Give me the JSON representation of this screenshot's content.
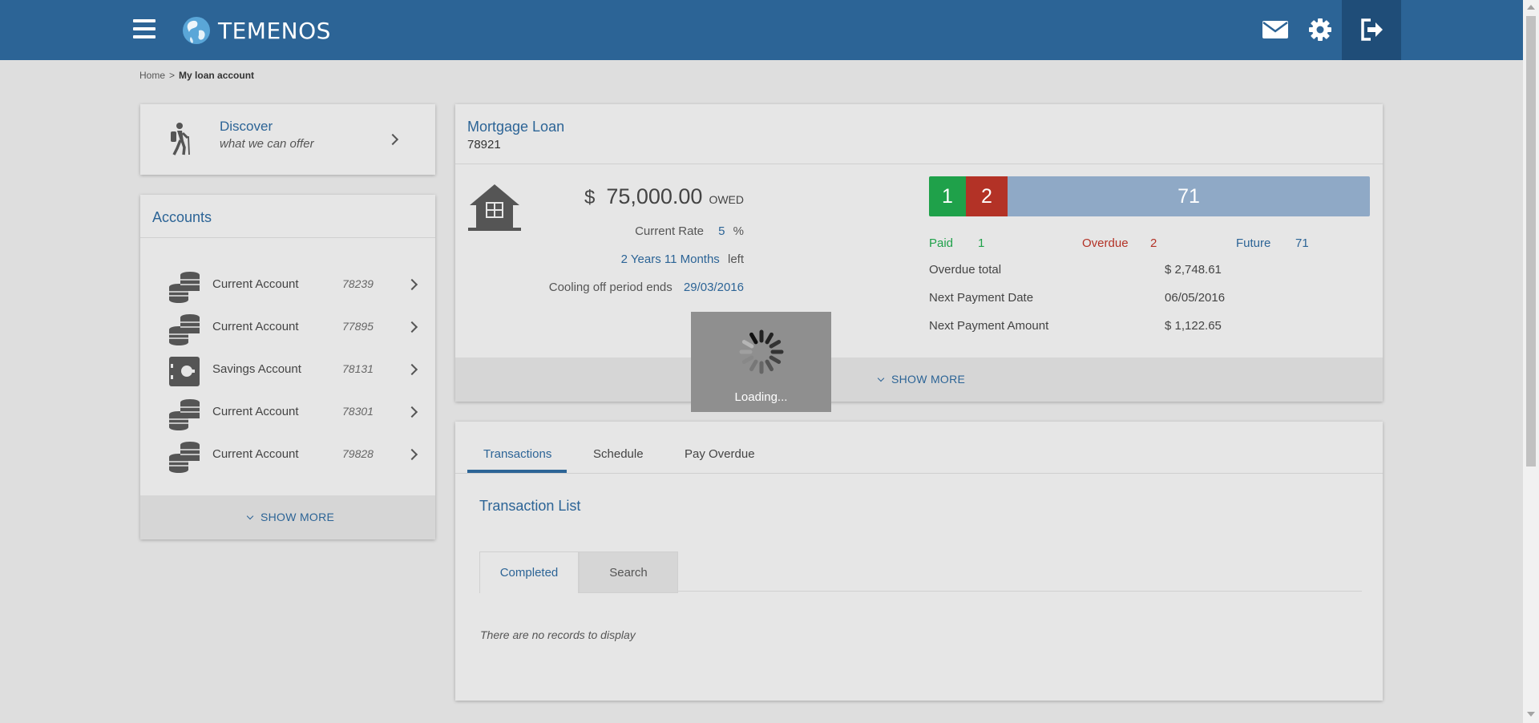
{
  "brand": {
    "name": "TEMENOS"
  },
  "breadcrumb": {
    "home": "Home",
    "separator": ">",
    "current": "My loan account"
  },
  "discover": {
    "title": "Discover",
    "subtitle": "what we can offer"
  },
  "accounts": {
    "title": "Accounts",
    "items": [
      {
        "name": "Current Account",
        "number": "78239",
        "icon": "coins-stack-icon"
      },
      {
        "name": "Current Account",
        "number": "77895",
        "icon": "coins-stack-icon"
      },
      {
        "name": "Savings Account",
        "number": "78131",
        "icon": "safe-icon"
      },
      {
        "name": "Current Account",
        "number": "78301",
        "icon": "coins-stack-icon"
      },
      {
        "name": "Current Account",
        "number": "79828",
        "icon": "coins-stack-icon"
      }
    ],
    "show_more": "SHOW MORE"
  },
  "loan": {
    "title": "Mortgage Loan",
    "number": "78921",
    "currency": "$",
    "amount": "75,000.00",
    "owed_label": "OWED",
    "rate_label": "Current Rate",
    "rate_value": "5",
    "rate_unit": "%",
    "term_value": "2 Years 11 Months",
    "term_suffix": "left",
    "cooling_label": "Cooling off period ends",
    "cooling_value": "29/03/2016",
    "bar": {
      "paid": "1",
      "overdue": "2",
      "future": "71"
    },
    "stats": {
      "paid_label": "Paid",
      "paid_value": "1",
      "overdue_label": "Overdue",
      "overdue_value": "2",
      "future_label": "Future",
      "future_value": "71"
    },
    "overdue_total_label": "Overdue total",
    "overdue_total_value": "$  2,748.61",
    "next_date_label": "Next Payment Date",
    "next_date_value": "06/05/2016",
    "next_amount_label": "Next Payment Amount",
    "next_amount_value": "$  1,122.65",
    "show_more": "SHOW MORE"
  },
  "loading": {
    "text": "Loading..."
  },
  "transactions": {
    "tabs": [
      "Transactions",
      "Schedule",
      "Pay Overdue"
    ],
    "list_title": "Transaction List",
    "subtabs": [
      "Completed",
      "Search"
    ],
    "empty_text": "There are no records to display"
  },
  "colors": {
    "header": "#2c6496",
    "logout_bg": "#1f4d78",
    "paid": "#1fa14a",
    "overdue": "#b33226",
    "future": "#8fa9c6"
  }
}
